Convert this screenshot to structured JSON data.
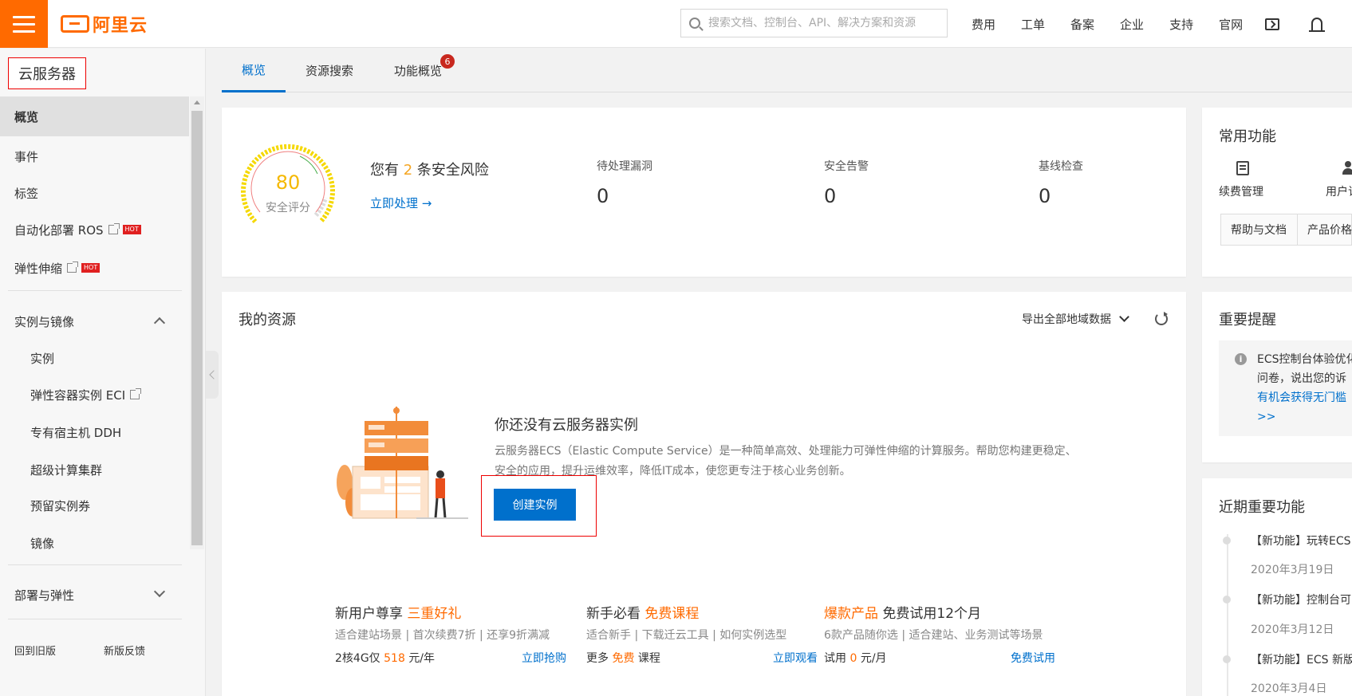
{
  "header": {
    "logo_text": "阿里云",
    "search_placeholder": "搜索文档、控制台、API、解决方案和资源",
    "nav": [
      "费用",
      "工单",
      "备案",
      "企业",
      "支持",
      "官网"
    ],
    "icons": [
      "menu-icon",
      "search-icon",
      "terminal-icon",
      "bell-icon"
    ],
    "brand_color": "#ff6a00"
  },
  "sidebar": {
    "title": "云服务器",
    "items": [
      "概览",
      "事件",
      "标签",
      "自动化部署 ROS",
      "弹性伸缩"
    ],
    "hot": "HOT",
    "group1": {
      "label": "实例与镜像",
      "items": [
        "实例",
        "弹性容器实例 ECI",
        "专有宿主机 DDH",
        "超级计算集群",
        "预留实例券",
        "镜像"
      ]
    },
    "group2_label": "部署与弹性",
    "bottom_items": [
      "回到旧版",
      "新版反馈"
    ]
  },
  "tabs": [
    {
      "label": "概览",
      "active": true
    },
    {
      "label": "资源搜索"
    },
    {
      "label": "功能概览",
      "badge": "6"
    }
  ],
  "security": {
    "score": "80",
    "score_label": "安全评分",
    "risk_prefix": "您有",
    "risk_count": "2",
    "risk_suffix": "条安全风险",
    "action": "立即处理",
    "stats": [
      {
        "label": "待处理漏洞",
        "value": "0"
      },
      {
        "label": "安全告警",
        "value": "0"
      },
      {
        "label": "基线检查",
        "value": "0"
      }
    ]
  },
  "resources": {
    "title": "我的资源",
    "export": "导出全部地域数据",
    "empty_title": "你还没有云服务器实例",
    "empty_desc": "云服务器ECS（Elastic Compute Service）是一种简单高效、处理能力可弹性伸缩的计算服务。帮助您构建更稳定、安全的应用，提升运维效率，降低IT成本，使您更专注于核心业务创新。",
    "create_button": "创建实例"
  },
  "promos": [
    {
      "title_a": "新用户尊享",
      "title_hl": "三重好礼",
      "title_b": "",
      "sub": "适合建站场景 | 首次续费7折 | 还享9折满减",
      "row_a": "2核4G仅",
      "row_hl": "518",
      "row_b": "元/年",
      "link": "立即抢购"
    },
    {
      "title_a": "新手必看",
      "title_hl": "免费课程",
      "title_b": "",
      "sub": "适合新手 | 下载迁云工具 | 如何实例选型",
      "row_a": "更多",
      "row_hl": "免费",
      "row_b": "课程",
      "link": "立即观看"
    },
    {
      "title_a": "",
      "title_hl": "爆款产品",
      "title_b": "免费试用12个月",
      "sub": "6款产品随你选 | 适合建站、业务测试等场景",
      "row_a": "试用",
      "row_hl": "0",
      "row_b": "元/月",
      "link": "免费试用"
    }
  ],
  "right": {
    "common_title": "常用功能",
    "functions": [
      "续费管理",
      "用户订"
    ],
    "fn_tabs": [
      "帮助与文档",
      "产品价格"
    ],
    "notice_title": "重要提醒",
    "notice_lines": [
      "ECS控制台体验优化",
      "问卷，说出您的诉",
      "有机会获得无门槛",
      ">>"
    ],
    "recent_title": "近期重要功能",
    "recent": [
      {
        "title": "【新功能】玩转ECS",
        "date": "2020年3月19日"
      },
      {
        "title": "【新功能】控制台可",
        "date": "2020年3月12日"
      },
      {
        "title": "【新功能】ECS 新版",
        "date": "2020年3月4日"
      }
    ]
  },
  "colors": {
    "accent": "#0070cc",
    "score": "#f5b800",
    "danger": "#e02020"
  }
}
